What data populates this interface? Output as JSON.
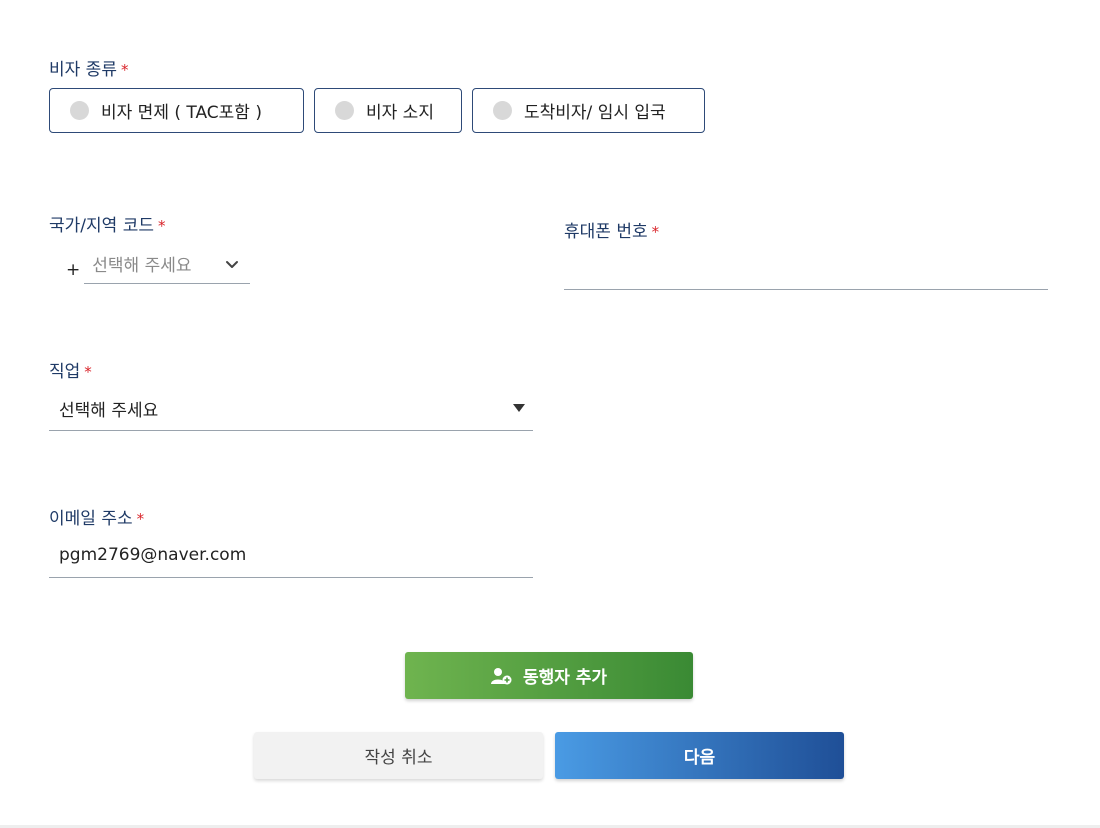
{
  "visa": {
    "label": "비자 종류",
    "required_mark": "*",
    "options": [
      {
        "label": "비자 면제 ( TAC포함 )"
      },
      {
        "label": "비자 소지"
      },
      {
        "label": "도착비자/ 임시 입국"
      }
    ]
  },
  "country_code": {
    "label": "국가/지역 코드",
    "required_mark": "*",
    "prefix": "+",
    "placeholder": "선택해 주세요"
  },
  "phone": {
    "label": "휴대폰 번호",
    "required_mark": "*",
    "value": ""
  },
  "job": {
    "label": "직업",
    "required_mark": "*",
    "selected": "선택해 주세요"
  },
  "email": {
    "label": "이메일 주소",
    "required_mark": "*",
    "value": "pgm2769@naver.com"
  },
  "buttons": {
    "add_companion": "동행자 추가",
    "cancel": "작성 취소",
    "next": "다음"
  },
  "colors": {
    "label": "#1f3a66",
    "required": "#d9252b",
    "add_button": "#4f9c3f",
    "next_button": "#2f6fbf"
  }
}
